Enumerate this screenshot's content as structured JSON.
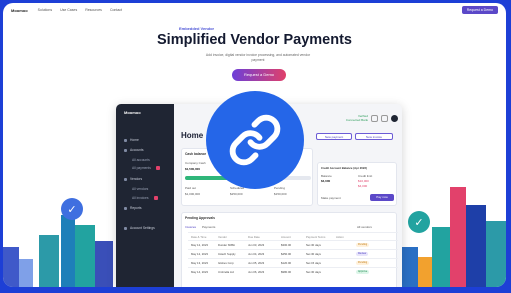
{
  "nav": {
    "logo": "Moomoo",
    "links": [
      "Solutions",
      "Use Cases",
      "Resources",
      "Contact"
    ],
    "cta": "Request a Demo"
  },
  "hero": {
    "eyebrow": "Embedded Vendor",
    "title": "Simplified Vendor Payments",
    "subtitle": "Add invoice, digital vendor invoice processing, and automated vendor payment",
    "cta": "Request a Demo"
  },
  "app": {
    "brand": "Moomoo",
    "sidebar": [
      {
        "label": "Home",
        "sub": false,
        "badge": false
      },
      {
        "label": "Accounts",
        "sub": false,
        "badge": false
      },
      {
        "label": "All accounts",
        "sub": true,
        "badge": false
      },
      {
        "label": "All payments",
        "sub": true,
        "badge": true
      },
      {
        "label": "Vendors",
        "sub": false,
        "badge": false
      },
      {
        "label": "All vendors",
        "sub": true,
        "badge": false
      },
      {
        "label": "All invoices",
        "sub": true,
        "badge": true
      },
      {
        "label": "Reports",
        "sub": false,
        "badge": false
      },
      {
        "label": "Account Settings",
        "sub": false,
        "badge": false
      }
    ],
    "status_line1": "Verified",
    "status_line2": "Connected Bank",
    "page_title": "Home",
    "btn_new_payment": "New payment",
    "btn_new_invoice": "New invoice",
    "cash_card": {
      "title": "Cash balance",
      "label_a": "Company Cash",
      "value_a": "$1,500,000",
      "value_b": "$1,000,000",
      "label_c": "Paid out",
      "value_c": "$1,000,000",
      "label_d": "Scheduled",
      "value_d": "$250,000",
      "label_e": "Pending",
      "value_e": "$150,000"
    },
    "credit_card": {
      "title": "Credit Account Balance (Apr 2023)",
      "label_a": "Balance",
      "value_a": "$4,000",
      "label_b": "Credit limit",
      "value_b": "$10,000",
      "value_c": "$4,000",
      "value_d": "$1,000",
      "label_e": "Make payment",
      "btn": "Pay now"
    },
    "pending": {
      "title": "Pending Approvals",
      "tabs": [
        "Invoices",
        "Payments"
      ],
      "filter": "All vendors",
      "headers": [
        "Date & Time",
        "Vendor",
        "Due Date",
        "Amount",
        "Payment Terms",
        "Action"
      ],
      "rows": [
        [
          "May 12, 2023",
          "Dunder Mifflin",
          "Jun 03, 2023",
          "$300.00",
          "Net 30 days",
          "Pending"
        ],
        [
          "May 12, 2023",
          "Initech Supply",
          "Jun 04, 2023",
          "$450.00",
          "Net 30 days",
          "Review"
        ],
        [
          "May 13, 2023",
          "Globex Corp",
          "Jun 05, 2023",
          "$120.00",
          "Net 15 days",
          "Pending"
        ],
        [
          "May 14, 2023",
          "Umbrella Ltd",
          "Jun 06, 2023",
          "$980.00",
          "Net 30 days",
          "Approve"
        ]
      ]
    }
  },
  "colors": {
    "frame_border": "#1d3fd6",
    "link_badge": "#2566e8",
    "accent": "#5b48c8",
    "cta_gradient_start": "#6d3fd8",
    "cta_gradient_end": "#e0406a"
  },
  "icons": {
    "center": "link-icon",
    "left_badge": "check-icon",
    "right_badge": "check-icon"
  }
}
